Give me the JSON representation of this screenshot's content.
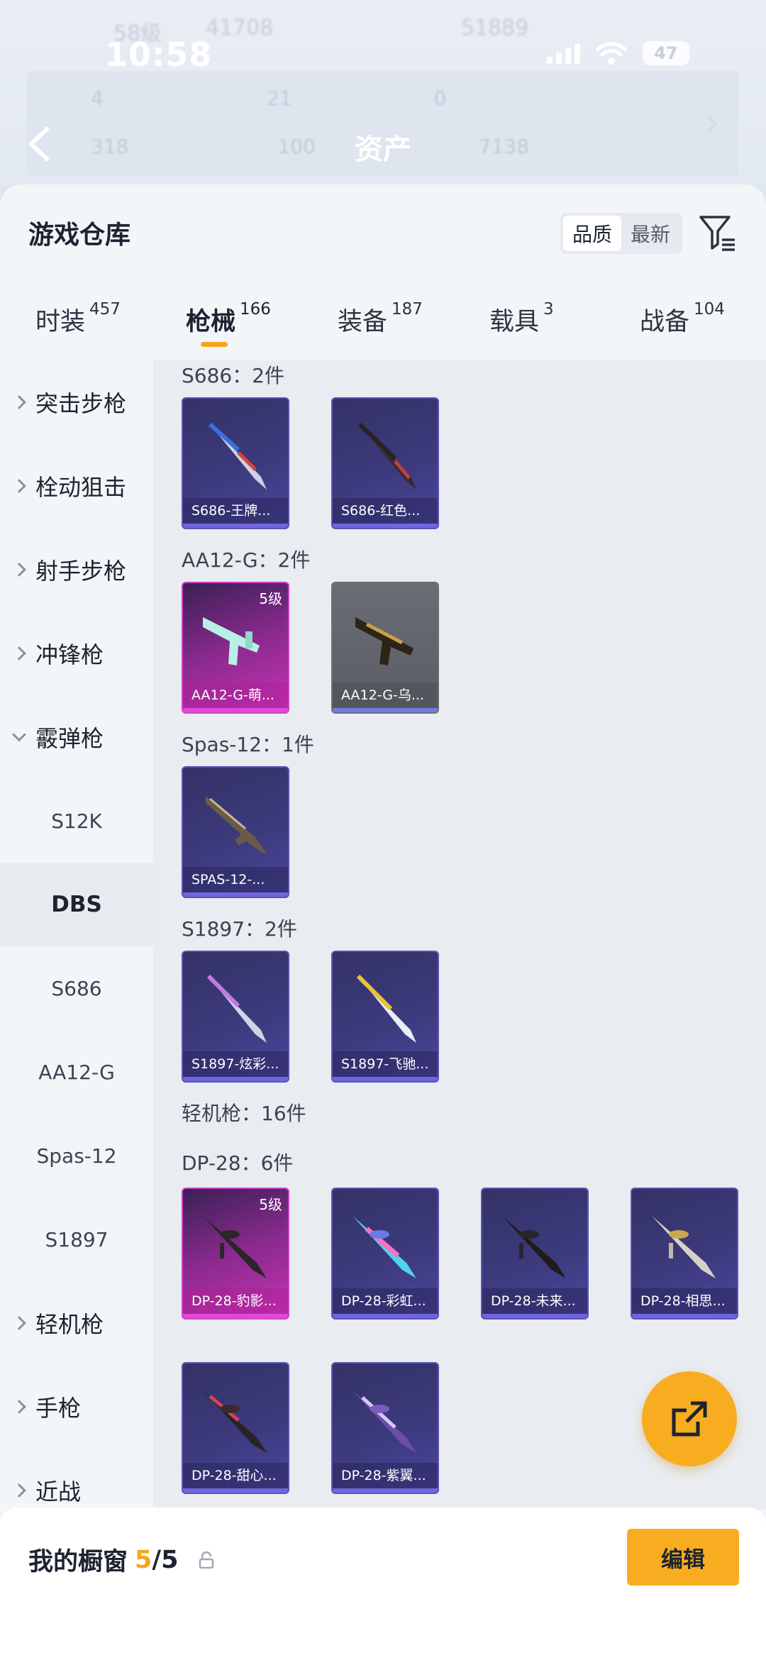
{
  "status_bar": {
    "time": "10:58",
    "battery": "47"
  },
  "background_overlay": {
    "ghost_text_left": "58级",
    "ghost_value_left": "41708",
    "ghost_value_right": "51889",
    "stats_row1": [
      "4",
      "21",
      "0"
    ],
    "stats_row2": [
      "318",
      "100",
      "7138"
    ],
    "title": "资产"
  },
  "header": {
    "title": "游戏仓库",
    "sort_options": [
      "品质",
      "最新"
    ]
  },
  "tabs": [
    {
      "label": "时装",
      "count": "457"
    },
    {
      "label": "枪械",
      "count": "166"
    },
    {
      "label": "装备",
      "count": "187"
    },
    {
      "label": "载具",
      "count": "3"
    },
    {
      "label": "战备",
      "count": "104"
    }
  ],
  "sidebar": {
    "items": [
      {
        "label": "突击步枪"
      },
      {
        "label": "栓动狙击"
      },
      {
        "label": "射手步枪"
      },
      {
        "label": "冲锋枪"
      },
      {
        "label": "霰弹枪"
      },
      {
        "label": "S12K"
      },
      {
        "label": "DBS"
      },
      {
        "label": "S686"
      },
      {
        "label": "AA12-G"
      },
      {
        "label": "Spas-12"
      },
      {
        "label": "S1897"
      },
      {
        "label": "轻机枪"
      },
      {
        "label": "手枪"
      },
      {
        "label": "近战"
      }
    ]
  },
  "content": {
    "groups": [
      {
        "title": "S686：2件"
      },
      {
        "title": "AA12-G：2件"
      },
      {
        "title": "Spas-12：1件"
      },
      {
        "title": "S1897：2件"
      },
      {
        "title": "轻机枪：16件"
      },
      {
        "title": "DP-28：6件"
      }
    ],
    "items": [
      {
        "name": "S686-王牌...",
        "level": ""
      },
      {
        "name": "S686-红色...",
        "level": ""
      },
      {
        "name": "AA12-G-萌...",
        "level": "5级"
      },
      {
        "name": "AA12-G-乌...",
        "level": ""
      },
      {
        "name": "SPAS-12-...",
        "level": ""
      },
      {
        "name": "S1897-炫彩...",
        "level": ""
      },
      {
        "name": "S1897-飞驰...",
        "level": ""
      },
      {
        "name": "DP-28-豹影...",
        "level": "5级"
      },
      {
        "name": "DP-28-彩虹...",
        "level": ""
      },
      {
        "name": "DP-28-未来...",
        "level": ""
      },
      {
        "name": "DP-28-相思...",
        "level": ""
      },
      {
        "name": "DP-28-甜心...",
        "level": ""
      },
      {
        "name": "DP-28-紫翼...",
        "level": ""
      }
    ]
  },
  "bottom_bar": {
    "title": "我的橱窗",
    "count_current": "5",
    "count_total": "/5",
    "edit_label": "编辑"
  },
  "colors": {
    "accent": "#f7ad1f",
    "purple_card": "#3c3a7c",
    "pink_card": "#c933b4"
  }
}
